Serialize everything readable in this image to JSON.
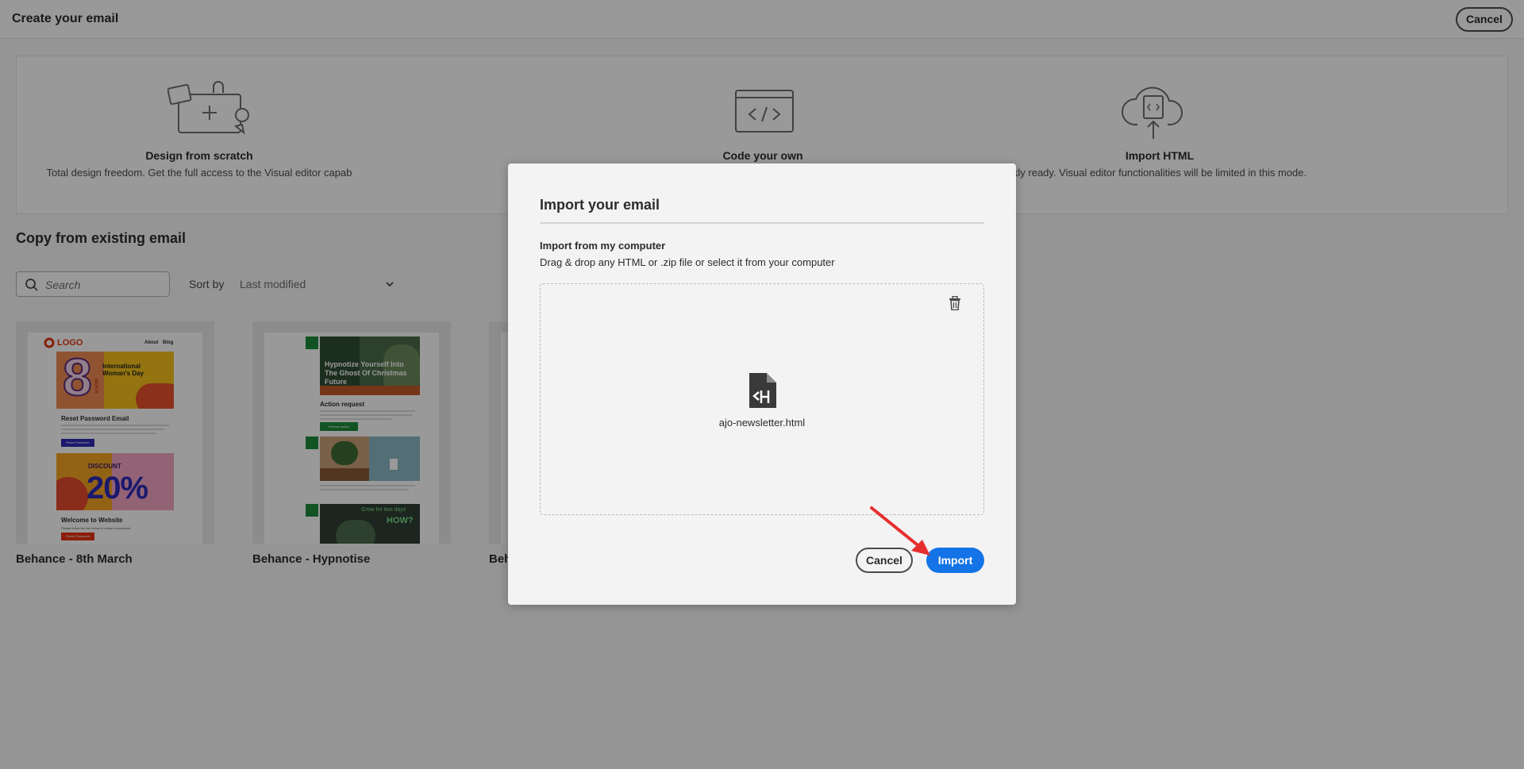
{
  "header": {
    "title": "Create your email",
    "cancel_label": "Cancel"
  },
  "create_options": [
    {
      "name": "Design from scratch",
      "description": "Total design freedom. Get the full access to the Visual editor capab",
      "icon": "canvas-illustration-icon"
    },
    {
      "name": "Code your own",
      "description": "",
      "icon": "code-window-icon"
    },
    {
      "name": "Import HTML",
      "description": "kly ready. Visual editor functionalities will be limited in this mode.",
      "icon": "cloud-upload-html-icon"
    }
  ],
  "copy_section": {
    "title": "Copy from existing email",
    "search_placeholder": "Search",
    "sort_label": "Sort by",
    "sort_value": "Last modified",
    "cards": [
      {
        "label": "Behance - 8th March"
      },
      {
        "label": "Behance - Hypnotise"
      },
      {
        "label": "Beh"
      }
    ]
  },
  "thumb_8march": {
    "logo": "LOGO",
    "nav": [
      "About",
      "Blog"
    ],
    "big_number": "8",
    "month": "MARCH",
    "headline": "International Woman's Day",
    "reset_title": "Reset Password Email",
    "reset_button": "Reset Password",
    "discount_label": "DISCOUNT",
    "discount_value": "20%",
    "welcome_title": "Welcome to Website",
    "welcome_text": "Please follow the link below to create a password",
    "welcome_button": "Create Password"
  },
  "thumb_hypnotise": {
    "hero_text": "Hypnotize Yourself Into The Ghost Of Christmas Future",
    "action_title": "Action request",
    "action_button": "Perform action",
    "grow_text": "Grow for two days",
    "how_text": "HOW?"
  },
  "modal": {
    "title": "Import your email",
    "subtitle": "Import from my computer",
    "hint": "Drag & drop any HTML or .zip file or select it from your computer",
    "file_name": "ajo-newsletter.html",
    "cancel_label": "Cancel",
    "import_label": "Import"
  },
  "colors": {
    "accent_blue": "#1473e6",
    "annotation_arrow": "#e62e2e"
  }
}
